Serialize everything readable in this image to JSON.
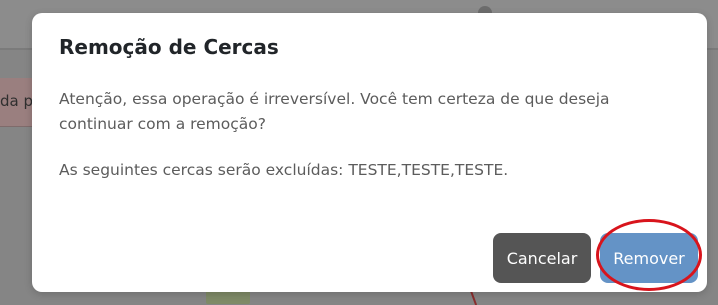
{
  "background": {
    "alert_text_fragment": "da p"
  },
  "modal": {
    "title": "Remoção de Cercas",
    "warning": "Atenção, essa operação é irreversível. Você tem certeza de que deseja continuar com a remoção?",
    "fences_message": "As seguintes cercas serão excluídas: TESTE,TESTE,TESTE.",
    "cancel_label": "Cancelar",
    "remove_label": "Remover"
  },
  "colors": {
    "overlay": "#858585",
    "cancel_button": "#555555",
    "remove_button": "#6493c6",
    "highlight_ring": "#d8141c"
  }
}
